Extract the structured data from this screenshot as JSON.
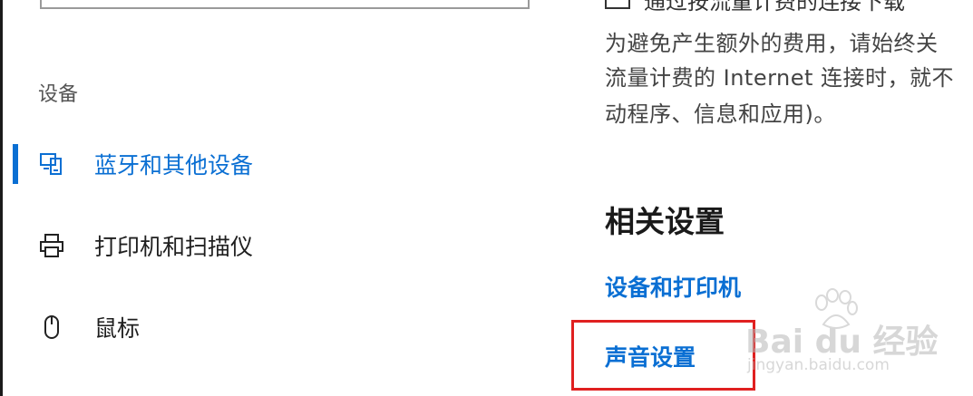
{
  "sidebar": {
    "section_title": "设备",
    "items": [
      {
        "label": "蓝牙和其他设备",
        "icon": "bluetooth-devices-icon",
        "active": true
      },
      {
        "label": "打印机和扫描仪",
        "icon": "printer-icon",
        "active": false
      },
      {
        "label": "鼠标",
        "icon": "mouse-icon",
        "active": false
      }
    ]
  },
  "main": {
    "checkbox_label": "通过按流量计费的连接下载",
    "description_lines": [
      "为避免产生额外的费用，请始终关",
      "流量计费的 Internet 连接时，就不",
      "动程序、信息和应用)。"
    ],
    "related_title": "相关设置",
    "links": [
      {
        "label": "设备和打印机"
      },
      {
        "label": "声音设置"
      }
    ]
  },
  "watermark": {
    "main": "Bai du 经验",
    "sub": "jingyan.baidu.com"
  },
  "colors": {
    "accent": "#0a6fd3",
    "highlight": "#e02020"
  }
}
